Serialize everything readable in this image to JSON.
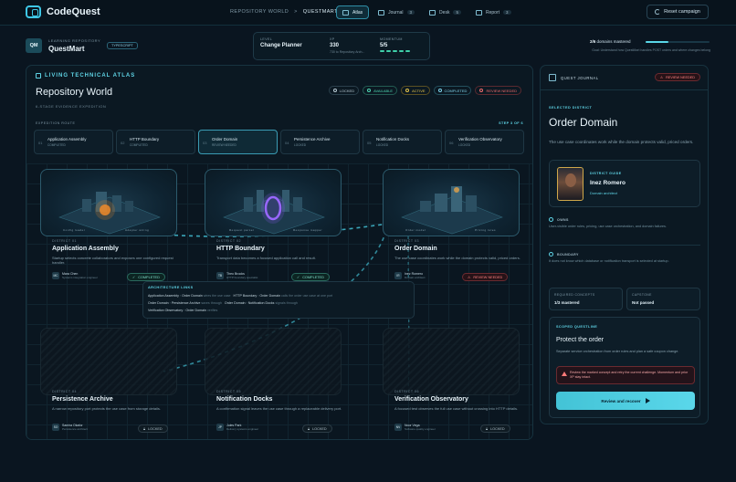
{
  "app": {
    "name": "CodeQuest"
  },
  "breadcrumb": {
    "section": "REPOSITORY WORLD",
    "sep": ">",
    "current": "QUESTMART"
  },
  "nav": [
    {
      "label": "Atlas",
      "count": ""
    },
    {
      "label": "Journal",
      "count": "3"
    },
    {
      "label": "Desk",
      "count": "5"
    },
    {
      "label": "Report",
      "count": "3"
    }
  ],
  "reset_label": "Reset campaign",
  "repo": {
    "kicker": "LEARNING REPOSITORY",
    "name": "QuestMart",
    "avatar": "QM",
    "language": "TYPESCRIPT"
  },
  "stats": {
    "level_k": "LEVEL",
    "level_v": "Change Planner",
    "xp_k": "XP",
    "xp_v": "330",
    "xp_s": "730 to Repository Arch...",
    "momentum_k": "MOMENTUM",
    "momentum_v": "5/5"
  },
  "progress": {
    "mastered": "2/6",
    "label": "domains mastered",
    "fraction": 0.35,
    "goal": "Goal: Understand how QuestMart handles POST orders and where changes belong"
  },
  "atlas": {
    "kicker": "LIVING TECHNICAL ATLAS",
    "title": "Repository World",
    "subtitle": "6-STAGE EVIDENCE EXPEDITION",
    "legend": [
      "LOCKED",
      "AVAILABLE",
      "ACTIVE",
      "COMPLETED",
      "REVIEW NEEDED"
    ],
    "route_label": "EXPEDITION ROUTE",
    "route_step": "STEP 3 OF 6"
  },
  "route": [
    {
      "n": "01",
      "title": "Application Assembly",
      "status": "COMPLETED"
    },
    {
      "n": "02",
      "title": "HTTP Boundary",
      "status": "COMPLETED"
    },
    {
      "n": "03",
      "title": "Order Domain",
      "status": "REVIEW NEEDED"
    },
    {
      "n": "04",
      "title": "Persistence Archive",
      "status": "LOCKED"
    },
    {
      "n": "05",
      "title": "Notification Docks",
      "status": "LOCKED"
    },
    {
      "n": "06",
      "title": "Verification Observatory",
      "status": "LOCKED"
    }
  ],
  "districts": [
    {
      "kicker": "DISTRICT 01",
      "title": "Application Assembly",
      "desc": "Startup selects concrete collaborators and exposes one configured request handler.",
      "guide_init": "MC",
      "guide": "Mara Chen",
      "role": "Systems integration engineer",
      "status": "COMPLETED",
      "cap_l": "Config loader",
      "cap_r": "Adapter wiring"
    },
    {
      "kicker": "DISTRICT 02",
      "title": "HTTP Boundary",
      "desc": "Transport data becomes a focused application call and result.",
      "guide_init": "TB",
      "guide": "Theo Brooks",
      "role": "HTTP boundary specialist",
      "status": "COMPLETED",
      "cap_l": "Request parser",
      "cap_r": "Response mapper"
    },
    {
      "kicker": "DISTRICT 03",
      "title": "Order Domain",
      "desc": "The use case coordinates work while the domain protects valid, priced orders.",
      "guide_init": "IR",
      "guide": "Inez Romero",
      "role": "Domain architect",
      "status": "REVIEW NEEDED",
      "cap_l": "Order model",
      "cap_r": "Pricing rules"
    },
    {
      "kicker": "DISTRICT 04",
      "title": "Persistence Archive",
      "desc": "A narrow repository port protects the use case from storage details.",
      "guide_init": "SO",
      "guide": "Samira Okafor",
      "role": "Persistence architect",
      "status": "LOCKED"
    },
    {
      "kicker": "DISTRICT 05",
      "title": "Notification Docks",
      "desc": "A confirmation signal leaves the use case through a replaceable delivery port.",
      "guide_init": "JP",
      "guide": "Jules Park",
      "role": "Delivery systems engineer",
      "status": "LOCKED"
    },
    {
      "kicker": "DISTRICT 06",
      "title": "Verification Observatory",
      "desc": "A focused test observes the full use case without crossing into HTTP details.",
      "guide_init": "NV",
      "guide": "Noor Vega",
      "role": "Software quality engineer",
      "status": "LOCKED"
    }
  ],
  "arch": {
    "kicker": "ARCHITECTURE LINKS",
    "rows": [
      {
        "a": "Application Assembly",
        "b": "Order Domain",
        "note": "wires the use case",
        "c": "HTTP Boundary",
        "d": "Order Domain",
        "note2": "calls the order use case at one port"
      },
      {
        "a": "Order Domain",
        "b": "Persistence Archive",
        "note": "saves through",
        "c": "Order Domain",
        "d": "Notification Docks",
        "note2": "signals through"
      },
      {
        "a": "Verification Observatory",
        "b": "Order Domain",
        "note": "verifies",
        "c": "",
        "d": "",
        "note2": ""
      }
    ]
  },
  "journal": {
    "title": "QUEST JOURNAL",
    "status": "REVIEW NEEDED",
    "selected_k": "SELECTED DISTRICT",
    "selected_t": "Order Domain",
    "selected_d": "The use case coordinates work while the domain protects valid, priced orders.",
    "guide_k": "DISTRICT GUIDE",
    "guide_n": "Inez Romero",
    "guide_r": "Domain architect",
    "owns_k": "OWNS",
    "owns_t": "User-visible order rules, pricing, use case orchestration, and domain failures.",
    "boundary_k": "BOUNDARY",
    "boundary_t": "It does not know which database or notification transport is selected at startup.",
    "req_k": "REQUIRED CONCEPTS",
    "req_v": "1/3 mastered",
    "cap_k": "CAPSTONE",
    "cap_v": "Not passed",
    "quest_k": "SCOPED QUESTLINE",
    "quest_t": "Protect the order",
    "quest_d": "Separate service orchestration from order rules and plan a safe coupon change.",
    "warn": "Review the marked concept and retry the current challenge. Momentum and prior XP stay intact.",
    "btn": "Review and recover"
  },
  "colors": {
    "accent": "#5ad7ea",
    "review": "#ff7a7a",
    "available": "#4fd7b3",
    "active": "#e3c44a"
  }
}
